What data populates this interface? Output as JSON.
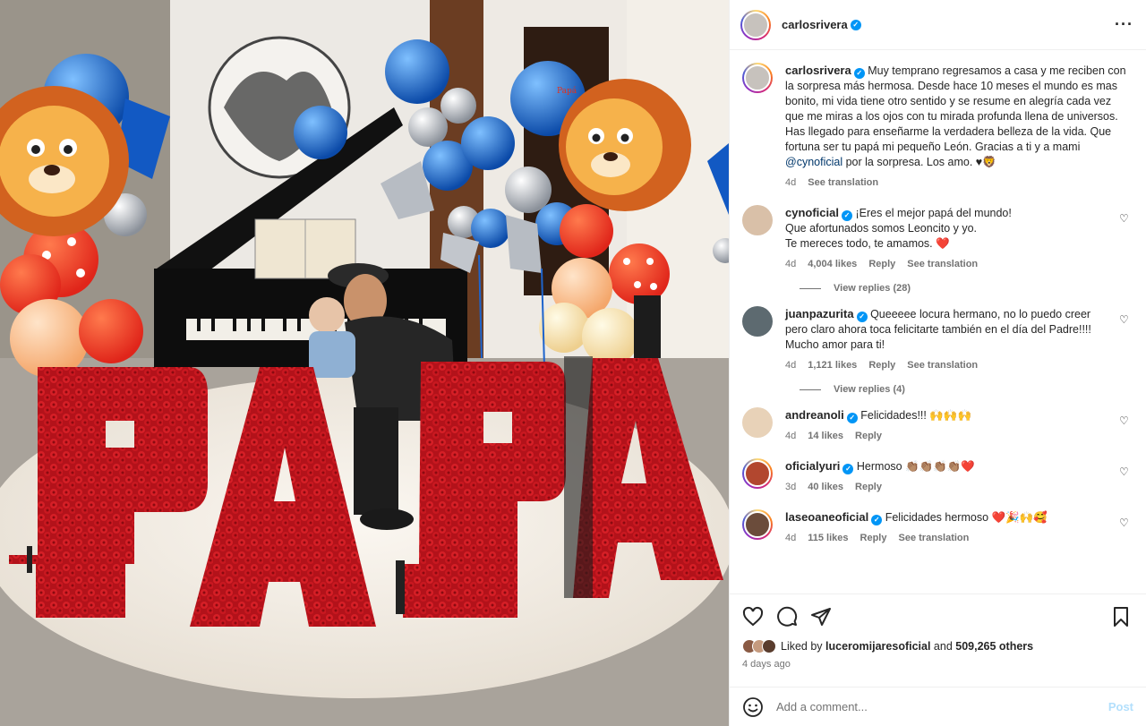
{
  "post": {
    "author": "carlosrivera",
    "more_icon": "more-horizontal-icon"
  },
  "caption": {
    "username": "carlosrivera",
    "text": "Muy temprano regresamos a casa y me reciben con la sorpresa más hermosa. Desde hace 10 meses el mundo es mas bonito, mi vida tiene otro sentido y se resume en alegría cada vez que me miras a los ojos con tu mirada profunda llena de universos. Has llegado para enseñarme la verdadera belleza de la vida. Que fortuna ser tu papá mi pequeño León. Gracias a ti y a mami ",
    "mention": "@cynoficial",
    "text_end": " por la sorpresa. Los amo. ♥🦁",
    "time": "4d",
    "translate": "See translation"
  },
  "comments": [
    {
      "username": "cynoficial",
      "text_lines": [
        "¡Eres el mejor papá del mundo!",
        "Que afortunados somos Leoncito y yo.",
        "Te mereces todo, te amamos. ❤️"
      ],
      "time": "4d",
      "likes": "4,004 likes",
      "reply": "Reply",
      "translate": "See translation",
      "replies": "View replies (28)"
    },
    {
      "username": "juanpazurita",
      "text_lines": [
        "Queeeee locura hermano, no lo puedo creer pero claro ahora toca felicitarte también en el día del Padre!!!! Mucho amor para ti!"
      ],
      "time": "4d",
      "likes": "1,121 likes",
      "reply": "Reply",
      "translate": "See translation",
      "replies": "View replies (4)"
    },
    {
      "username": "andreanoli",
      "text_lines": [
        "Felicidades!!! 🙌🙌🙌"
      ],
      "time": "4d",
      "likes": "14 likes",
      "reply": "Reply"
    },
    {
      "username": "oficialyuri",
      "text_lines": [
        "Hermoso 👏🏽👏🏽👏🏽👏🏽❤️"
      ],
      "time": "3d",
      "likes": "40 likes",
      "reply": "Reply"
    },
    {
      "username": "laseoaneoficial",
      "text_lines": [
        "Felicidades hermoso ❤️🎉🙌🥰"
      ],
      "time": "4d",
      "likes": "115 likes",
      "reply": "Reply",
      "translate": "See translation"
    }
  ],
  "actions": {
    "like_icon": "heart-icon",
    "comment_icon": "comment-icon",
    "share_icon": "share-icon",
    "save_icon": "bookmark-icon",
    "liked_by_prefix": "Liked by ",
    "liked_by_user": "luceromijaresoficial",
    "liked_by_and": " and ",
    "liked_by_count": "509,265 others",
    "time": "4 days ago"
  },
  "add_comment": {
    "emoji_icon": "emoji-icon",
    "placeholder": "Add a comment...",
    "post_label": "Post"
  },
  "photo": {
    "letters": [
      "P",
      "A",
      "P",
      "A"
    ],
    "balloon_text": "Papá"
  },
  "colors": {
    "verified": "#0095f6",
    "mention": "#00376b",
    "muted": "#737373",
    "post_button": "#b2dffc",
    "roses": "#c4161c"
  }
}
